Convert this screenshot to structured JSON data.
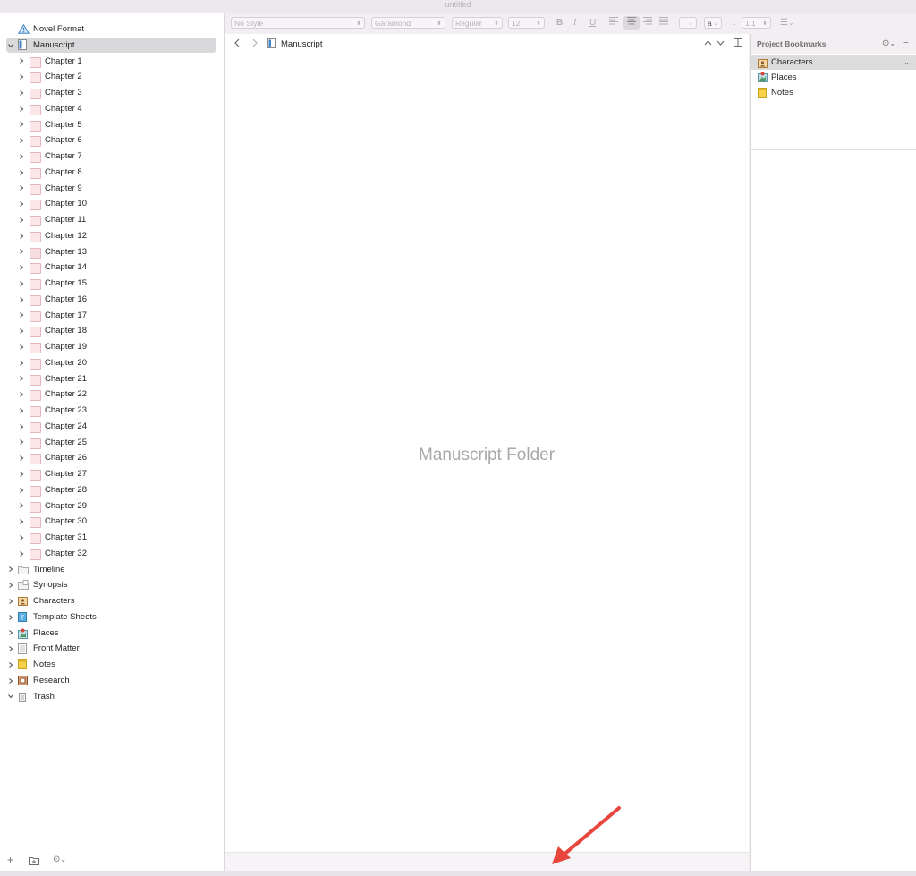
{
  "window": {
    "title": "untitled"
  },
  "binder": {
    "root_items": [
      {
        "label": "Novel Format",
        "icon": "warning-triangle-icon"
      },
      {
        "label": "Manuscript",
        "icon": "document-icon",
        "selected": true,
        "expanded": true
      }
    ],
    "chapters": [
      "Chapter 1",
      "Chapter 2",
      "Chapter 3",
      "Chapter 4",
      "Chapter 5",
      "Chapter 6",
      "Chapter 7",
      "Chapter 8",
      "Chapter 9",
      "Chapter 10",
      "Chapter 11",
      "Chapter 12",
      "Chapter 13",
      "Chapter 14",
      "Chapter 15",
      "Chapter 16",
      "Chapter 17",
      "Chapter 18",
      "Chapter 19",
      "Chapter 20",
      "Chapter 21",
      "Chapter 22",
      "Chapter 23",
      "Chapter 24",
      "Chapter 25",
      "Chapter 26",
      "Chapter 27",
      "Chapter 28",
      "Chapter 29",
      "Chapter 30",
      "Chapter 31",
      "Chapter 32"
    ],
    "other_items": [
      {
        "label": "Timeline",
        "icon": "folder-icon"
      },
      {
        "label": "Synopsis",
        "icon": "synopsis-folder-icon"
      },
      {
        "label": "Characters",
        "icon": "character-sheet-icon"
      },
      {
        "label": "Template Sheets",
        "icon": "template-icon"
      },
      {
        "label": "Places",
        "icon": "places-icon"
      },
      {
        "label": "Front Matter",
        "icon": "front-matter-icon"
      },
      {
        "label": "Notes",
        "icon": "notes-icon"
      },
      {
        "label": "Research",
        "icon": "research-icon"
      },
      {
        "label": "Trash",
        "icon": "trash-icon",
        "expanded": true
      }
    ]
  },
  "toolbar": {
    "style_select": "No Style",
    "font_select": "Garamond",
    "weight_select": "Regular",
    "size_select": "12",
    "bold": "B",
    "italic": "I",
    "underline": "U",
    "text_color_label": "a",
    "line_spacing": "1.1"
  },
  "editor": {
    "header_title": "Manuscript",
    "placeholder": "Manuscript Folder"
  },
  "inspector": {
    "title": "Project Bookmarks",
    "bookmarks": [
      {
        "label": "Characters",
        "icon": "character-sheet-icon",
        "selected": true
      },
      {
        "label": "Places",
        "icon": "places-icon"
      },
      {
        "label": "Notes",
        "icon": "notes-icon"
      }
    ]
  },
  "colors": {
    "annotation_arrow": "#e8453c",
    "selection": "#d9d9db",
    "chapter_folder": "#fbe6e8"
  }
}
